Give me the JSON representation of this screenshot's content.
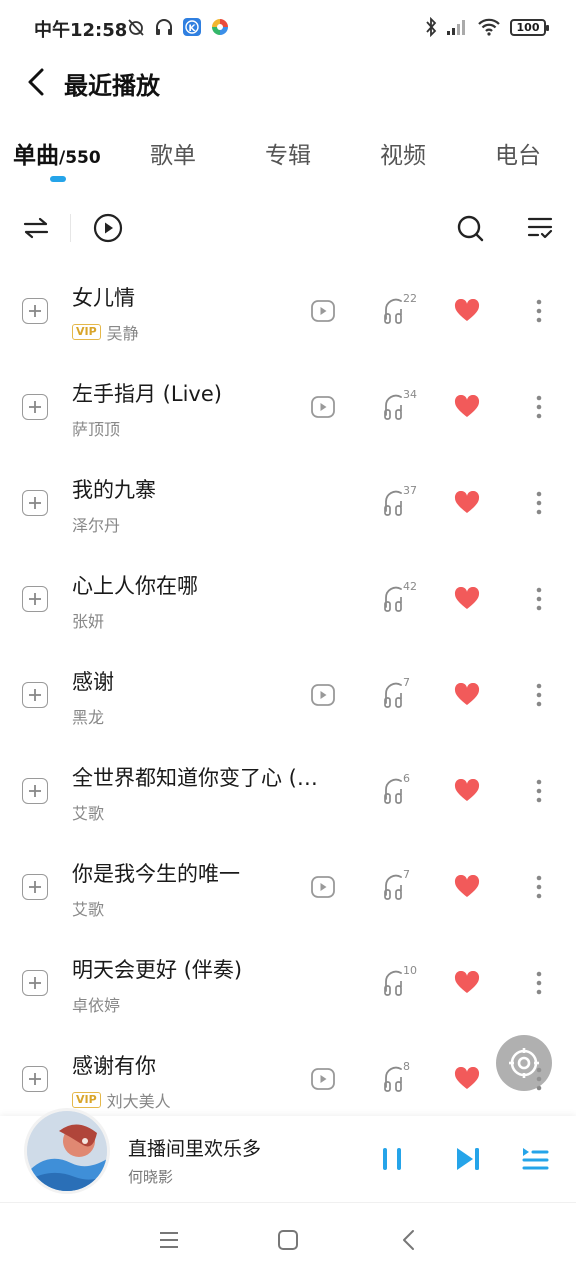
{
  "status_bar": {
    "time": "中午12:58",
    "battery": "100"
  },
  "header": {
    "title": "最近播放"
  },
  "tabs": [
    {
      "label": "单曲",
      "count": "/550"
    },
    {
      "label": "歌单"
    },
    {
      "label": "专辑"
    },
    {
      "label": "视频"
    },
    {
      "label": "电台"
    }
  ],
  "songs": [
    {
      "title": "女儿情",
      "artist": "吴静",
      "vip": "VIP",
      "quality": "22",
      "mv": true
    },
    {
      "title": "左手指月 (Live)",
      "artist": "萨顶顶",
      "vip": "",
      "quality": "34",
      "mv": true
    },
    {
      "title": "我的九寨",
      "artist": "泽尔丹",
      "vip": "",
      "quality": "37",
      "mv": false
    },
    {
      "title": "心上人你在哪",
      "artist": "张妍",
      "vip": "",
      "quality": "42",
      "mv": false
    },
    {
      "title": "感谢",
      "artist": "黑龙",
      "vip": "",
      "quality": "7",
      "mv": true
    },
    {
      "title": "全世界都知道你变了心 (…",
      "artist": "艾歌",
      "vip": "",
      "quality": "6",
      "mv": false
    },
    {
      "title": "你是我今生的唯一",
      "artist": "艾歌",
      "vip": "",
      "quality": "7",
      "mv": true
    },
    {
      "title": "明天会更好 (伴奏)",
      "artist": "卓依婷",
      "vip": "",
      "quality": "10",
      "mv": false
    },
    {
      "title": "感谢有你",
      "artist": "刘大美人",
      "vip": "VIP",
      "quality": "8",
      "mv": true
    }
  ],
  "player": {
    "title": "直播间里欢乐多",
    "artist": "何晓影"
  },
  "colors": {
    "accent": "#25a4e9",
    "heart": "#f25a5a",
    "vip": "#d9a52b"
  },
  "icons": {
    "back": "back-arrow-icon",
    "shuffle": "order-icon",
    "play_all": "play-circle-icon",
    "search": "search-icon",
    "manage": "list-check-icon",
    "add": "plus-square-icon",
    "mv": "video-icon",
    "quality": "headphone-icon",
    "favorite": "heart-icon",
    "more": "more-vertical-icon",
    "pause": "pause-icon",
    "next": "next-icon",
    "playlist": "playlist-icon"
  }
}
